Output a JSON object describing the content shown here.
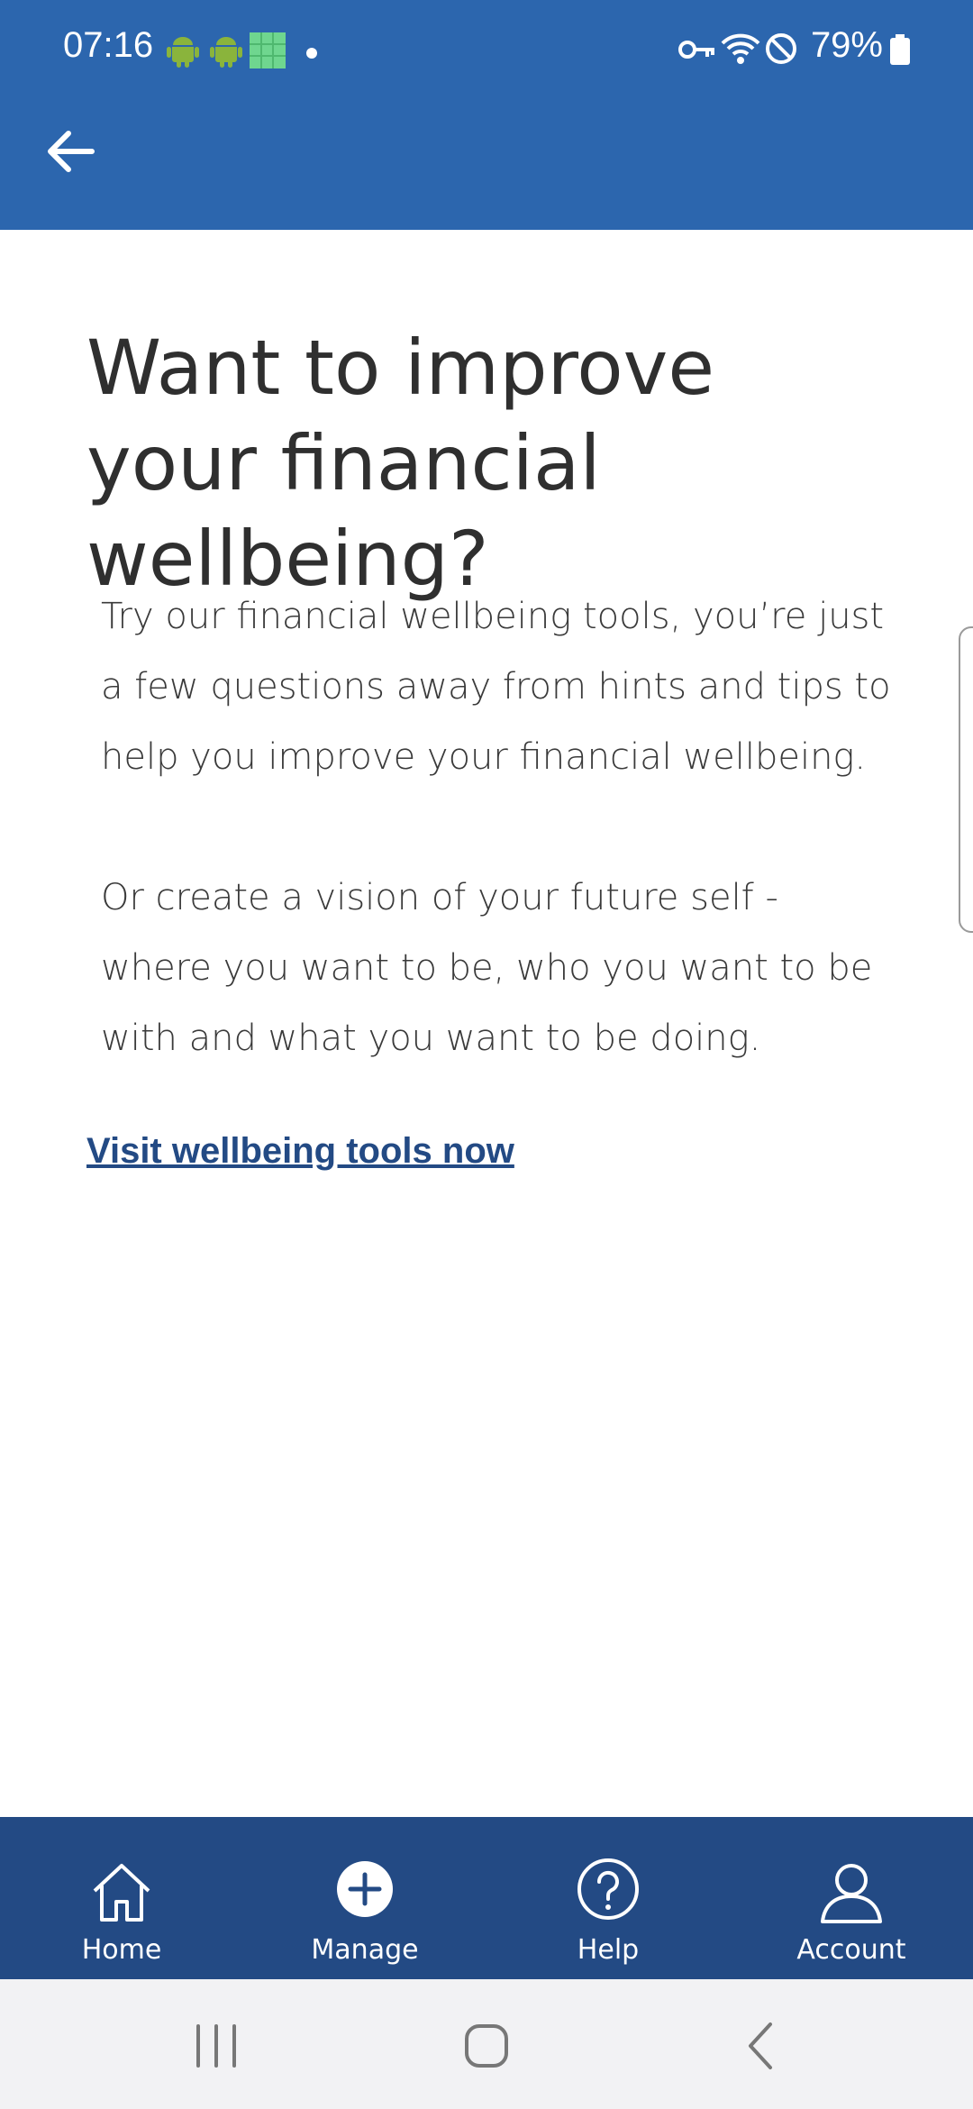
{
  "status_bar": {
    "time": "07:16",
    "battery": "79%",
    "icons": [
      "android-icon",
      "android-icon",
      "app-icon",
      "dot-icon",
      "vpn-key-icon",
      "wifi-icon",
      "do-not-disturb-icon",
      "battery-icon"
    ]
  },
  "app_bar": {
    "back_icon": "arrow-left-icon"
  },
  "main": {
    "title": "Want to improve your financial wellbeing?",
    "paragraph1": "Try our financial wellbeing tools, you’re just a few questions away from hints and tips to help you improve your financial wellbeing.",
    "paragraph2": "Or create a vision of your future self - where you want to be, who you want to be with and what you want to be doing.",
    "link_text": "Visit wellbeing tools now"
  },
  "bottom_nav": {
    "items": [
      {
        "label": "Home",
        "icon": "home-icon"
      },
      {
        "label": "Manage",
        "icon": "plus-circle-icon"
      },
      {
        "label": "Help",
        "icon": "help-circle-icon"
      },
      {
        "label": "Account",
        "icon": "account-icon"
      }
    ]
  },
  "system_nav": {
    "buttons": [
      "recent-apps-icon",
      "home-circle-icon",
      "back-chevron-icon"
    ]
  },
  "colors": {
    "app_bar": "#2c66ae",
    "bottom_nav": "#234a84",
    "link": "#234a84",
    "text": "#2f2f2f",
    "system_nav": "#f2f2f4"
  }
}
